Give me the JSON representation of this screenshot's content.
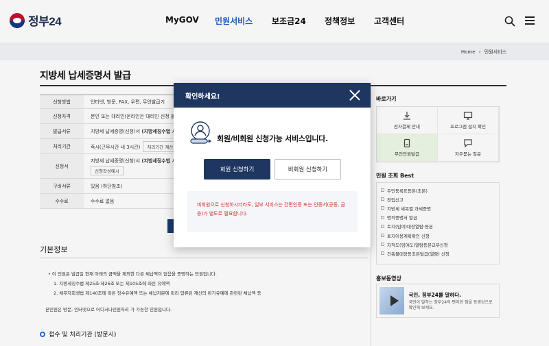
{
  "header": {
    "logo_text": "정부24",
    "nav": [
      "MyGOV",
      "민원서비스",
      "보조금24",
      "정책정보",
      "고객센터"
    ],
    "active_nav": "민원서비스"
  },
  "breadcrumb": {
    "home": "Home",
    "sep": "›",
    "current": "민원서비스"
  },
  "page": {
    "title": "지방세 납세증명서 발급"
  },
  "info_table": {
    "rows": [
      {
        "th": "신청방법",
        "td": "인터넷, 방문, FAX, 우편, 무인발급기"
      },
      {
        "th": "신청자격",
        "td": "본인 또는 대리인(온라인은 대리인 신청 불"
      },
      {
        "th": "발급서류",
        "td": "지방세 납세증명(신청)서 ",
        "td_bold": "(지방세징수법 시"
      },
      {
        "th": "처리기간",
        "td": "즉시(근무시간 내 3시간)",
        "btn": "처리기간 계산 방"
      },
      {
        "th": "신청서",
        "td": "지방세 납세증명(신청)서 ",
        "td_bold": "(지방세징수법 시",
        "sub_btn": "신청작성예시"
      },
      {
        "th": "구비서류",
        "td": "있음 (하단참조)"
      },
      {
        "th": "수수료",
        "td": "수수료 없음"
      }
    ]
  },
  "basic": {
    "title": "기본정보",
    "lines": [
      "• 이 민원은 발급일 현재 아래의 금액을 제외한 다른 체납액이 없음을 증명하는 민원입니다.",
      "1. 지방세징수법 제25조·제26조 또는 제105조에 따른 유예액",
      "2. 채무자회생법 제140조에 따른 징수유예액 또는 체납처분에 따라 압류된 재산의 환가유예에 관련된 체납액 등",
      "본민원은 방문, 인터넷으로 어디서나민원처리 가 가능한 민원입니다."
    ],
    "section": "접수 및 처리기관 (방문시)"
  },
  "sidebar": {
    "quick_title": "바로가기",
    "quick": [
      {
        "label": "전자결제 안내",
        "icon": "download-icon"
      },
      {
        "label": "프로그램 설치 확인",
        "icon": "monitor-icon"
      },
      {
        "label": "무인민원발급",
        "icon": "kiosk-icon"
      },
      {
        "label": "자주묻는 질문",
        "icon": "chat-icon"
      }
    ],
    "best_title": "민원 조회 Best",
    "best": [
      "주민등록표등본(초본)",
      "전입신고",
      "지방세 세목별 과세증명",
      "병적증명서 발급",
      "토지(임야)대장열람·등본",
      "토지이용계획확인 신청",
      "지적도(임야도)열람등본교부신청",
      "건축물대장등초본발급(열람) 신청"
    ],
    "promo_title": "홍보동영상",
    "promo_head": "국민, 정부24를 말하다.",
    "promo_body": "국민이 말하는 정부24의 편리한 점을 동영상으로 확인해 보세요."
  },
  "modal": {
    "title": "확인하세요!",
    "message": "회원/비회원 신청가능 서비스입니다.",
    "btn_member": "회원 신청하기",
    "btn_guest": "비회원 신청하기",
    "notice": "비회원으로 신청하시더라도, 일부 서비스는 간편인증 또는 인증서(공동, 금융)가 별도로 필요합니다."
  }
}
